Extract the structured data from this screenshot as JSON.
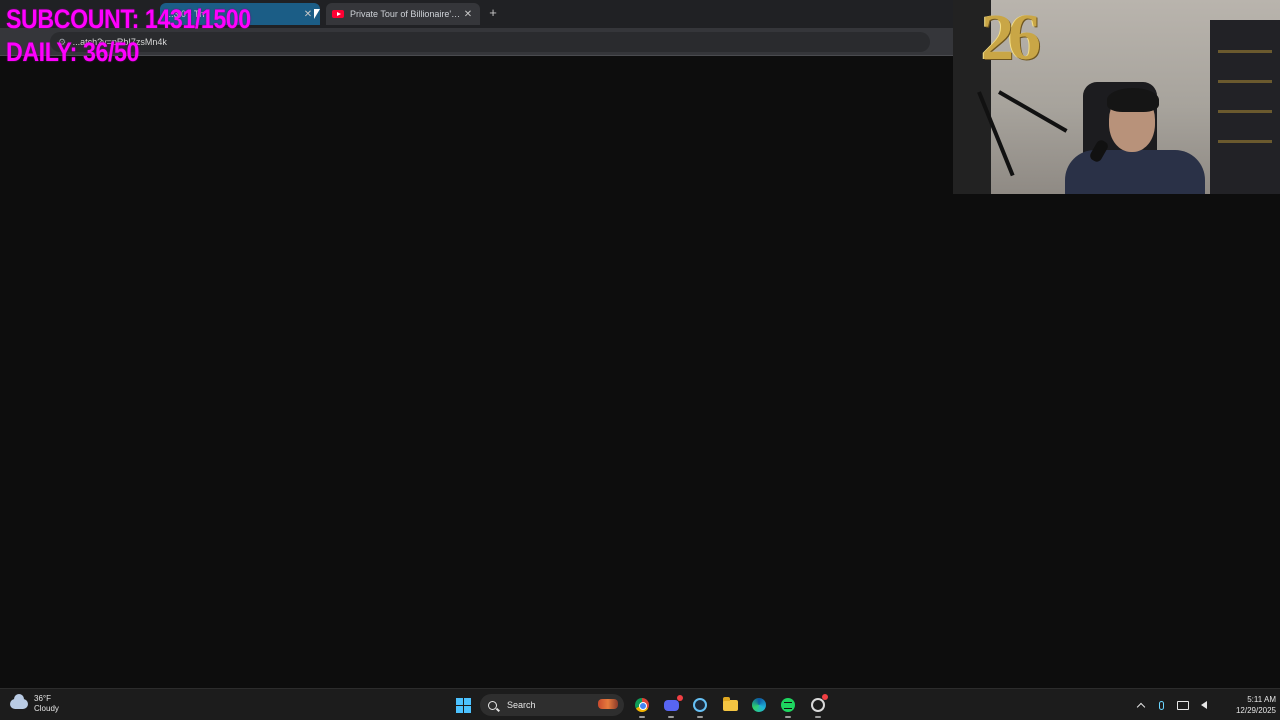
{
  "overlay": {
    "subcount": "SUBCOUNT: 1431/1500",
    "daily": "DAILY: 36/50"
  },
  "browser": {
    "tabs": [
      {
        "title": "...3.0 - Th",
        "active": true
      },
      {
        "title": "Private Tour of Billionaire's Secr",
        "icon": "youtube-icon",
        "active": false
      }
    ],
    "address": "...atch?v=pRbI7zsMn4k"
  },
  "webcam": {
    "wall_number": "26"
  },
  "taskbar": {
    "weather": {
      "temp": "36°F",
      "condition": "Cloudy"
    },
    "search_label": "Search",
    "apps": [
      "windows-start-icon",
      "chrome-icon",
      "discord-icon",
      "steam-icon",
      "file-explorer-icon",
      "edge-icon",
      "spotify-icon",
      "app-icon"
    ],
    "clock": {
      "time": "5:11 AM",
      "date": "12/29/2025"
    }
  },
  "colors": {
    "overlay_text": "#ff00ff",
    "page_background": "#0d0d0d",
    "taskbar": "#1c1c1c",
    "active_tab": "#1b5d86"
  }
}
